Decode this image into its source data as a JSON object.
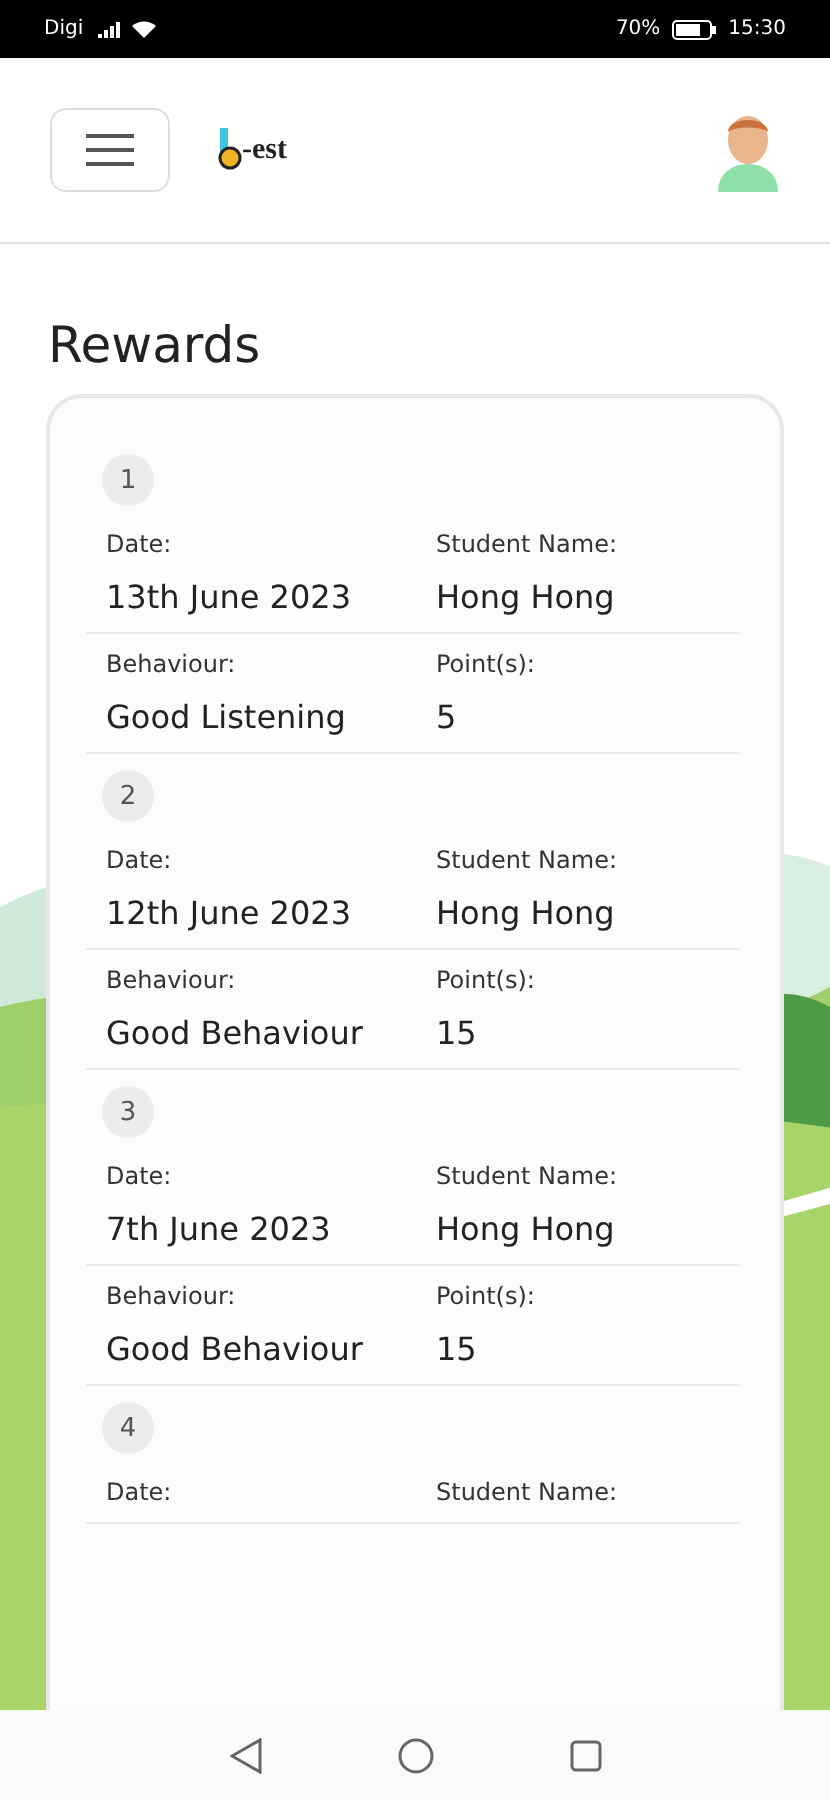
{
  "status_bar": {
    "carrier": "Digi",
    "battery": "70%",
    "time": "15:30"
  },
  "header": {
    "logo_text": "-est"
  },
  "title": "Rewards",
  "records": [
    {
      "number": "1",
      "rows": [
        [
          {
            "label": "Date:",
            "value": "13th June 2023"
          },
          {
            "label": "Student Name:",
            "value": "Hong Hong"
          }
        ],
        [
          {
            "label": "Behaviour:",
            "value": "Good Listening"
          },
          {
            "label": "Point(s):",
            "value": "5"
          }
        ]
      ]
    },
    {
      "number": "2",
      "rows": [
        [
          {
            "label": "Date:",
            "value": "12th June 2023"
          },
          {
            "label": "Student Name:",
            "value": "Hong Hong"
          }
        ],
        [
          {
            "label": "Behaviour:",
            "value": "Good Behaviour"
          },
          {
            "label": "Point(s):",
            "value": "15"
          }
        ]
      ]
    },
    {
      "number": "3",
      "rows": [
        [
          {
            "label": "Date:",
            "value": "7th June 2023"
          },
          {
            "label": "Student Name:",
            "value": "Hong Hong"
          }
        ],
        [
          {
            "label": "Behaviour:",
            "value": "Good Behaviour"
          },
          {
            "label": "Point(s):",
            "value": "15"
          }
        ]
      ]
    },
    {
      "number": "4",
      "rows": [
        [
          {
            "label": "Date:"
          },
          {
            "label": "Student Name:"
          }
        ]
      ]
    }
  ]
}
